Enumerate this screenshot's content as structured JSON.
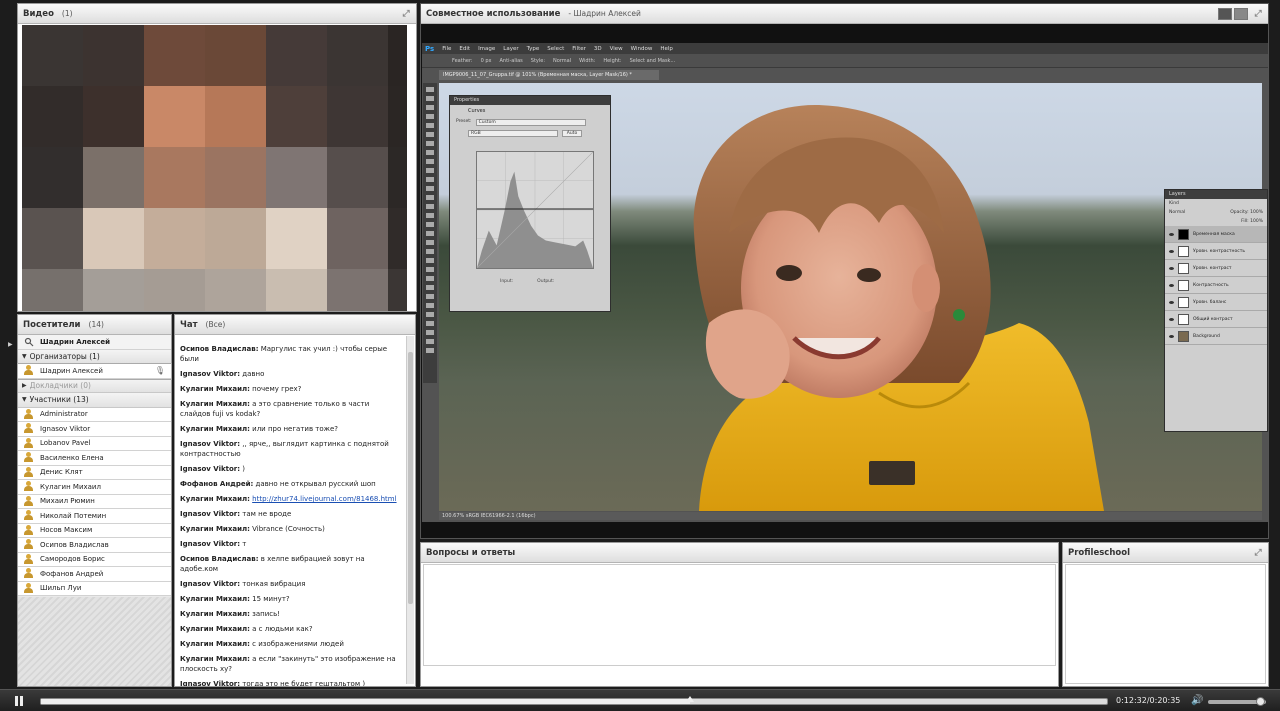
{
  "video_pod": {
    "title": "Видео",
    "count": "(1)"
  },
  "share_pod": {
    "title": "Совместное использование",
    "presenter": "- Шадрин Алексей"
  },
  "photoshop": {
    "logo": "Ps",
    "menu": [
      "File",
      "Edit",
      "Image",
      "Layer",
      "Type",
      "Select",
      "Filter",
      "3D",
      "View",
      "Window",
      "Help"
    ],
    "options": [
      "Feather:",
      "0 px",
      "Anti-alias",
      "Style:",
      "Normal",
      "Width:",
      "Height:",
      "Select and Mask..."
    ],
    "doc_tab": "IMGP9006_11_07_Gruppa.tif @ 101% (Временная маска, Layer Mask/16) *",
    "status": "100.67%    sRGB IEC61966-2.1 (16bpc)",
    "properties": {
      "title": "Properties",
      "adj": "Curves",
      "preset_label": "Preset:",
      "preset": "Custom",
      "channel": "RGB",
      "auto": "Auto",
      "input": "Input:",
      "output": "Output:"
    },
    "layers": {
      "title": "Layers",
      "kind": "Kind",
      "blend": "Normal",
      "opacity": "Opacity: 100%",
      "fill": "Fill: 100%",
      "items": [
        "Временная маска",
        "Уровн. контрастность",
        "Уровн. контраст",
        "Контрастность",
        "Уровн. баланс",
        "Общий контраст",
        "Background"
      ]
    }
  },
  "attendees_pod": {
    "title": "Посетители",
    "count": "(14)",
    "host": "Шадрин Алексей",
    "groups": [
      {
        "label": "Организаторы (1)"
      },
      {
        "label": "Докладчики (0)"
      },
      {
        "label": "Участники (13)"
      }
    ],
    "organizers": [
      "Шадрин Алексей"
    ],
    "participants": [
      "Administrator",
      "Ignasov Viktor",
      "Lobanov Pavel",
      "Василенко Елена",
      "Денис Клят",
      "Кулагин Михаил",
      "Михаил Рюмин",
      "Николай Потемин",
      "Носов Максим",
      "Осипов Владислав",
      "Самородов Борис",
      "Фофанов Андрей",
      "Шильп Луи"
    ]
  },
  "chat_pod": {
    "title": "Чат",
    "filter": "(Все)",
    "messages": [
      {
        "author": "Осипов Владислав:",
        "text": " Маргулис так учил :) чтобы серые были"
      },
      {
        "author": "Ignasov Viktor:",
        "text": " давно"
      },
      {
        "author": "Кулагин Михаил:",
        "text": " почему грех?"
      },
      {
        "author": "Кулагин Михаил:",
        "text": " а это сравнение только в части слайдов fuji vs kodak?"
      },
      {
        "author": "Кулагин Михаил:",
        "text": " или про негатив тоже?"
      },
      {
        "author": "Ignasov Viktor:",
        "text": " ,, ярче,, выглядит картинка с поднятой контрастностью"
      },
      {
        "author": "Ignasov Viktor:",
        "text": " )"
      },
      {
        "author": "Фофанов Андрей:",
        "text": " давно не открывал русский шоп"
      },
      {
        "author": "Кулагин Михаил:",
        "text": " ",
        "link": "http://zhur74.livejournal.com/81468.html"
      },
      {
        "author": "Ignasov Viktor:",
        "text": " там не вроде"
      },
      {
        "author": "Кулагин Михаил:",
        "text": "  Vibrance (Сочность)"
      },
      {
        "author": "Ignasov Viktor:",
        "text": " т"
      },
      {
        "author": "Осипов Владислав:",
        "text": " в хелпе вибрацией зовут на адобе.ком"
      },
      {
        "author": "Ignasov Viktor:",
        "text": " тонкая вибрация"
      },
      {
        "author": "Кулагин Михаил:",
        "text": " 15 минут?"
      },
      {
        "author": "Кулагин Михаил:",
        "text": " запись!"
      },
      {
        "author": "Кулагин Михаил:",
        "text": " а с людьми как?"
      },
      {
        "author": "Кулагин Михаил:",
        "text": " с изображениями людей"
      },
      {
        "author": "Кулагин Михаил:",
        "text": " а если \"закинуть\" это изображение на плоскость ху?"
      },
      {
        "author": "Ignasov Viktor:",
        "text": " тогда это не будет гештальтом )"
      }
    ]
  },
  "qa_pod": {
    "title": "Вопросы и ответы"
  },
  "profile_pod": {
    "title": "Profileschool"
  },
  "playback": {
    "time": "0:12:32/0:20:35",
    "progress": 0.609,
    "volume": 0.92
  },
  "colors": {
    "link": "#1a4fb3",
    "header_bg": "#e6e6e6",
    "stage_bg": "#111111"
  },
  "mosaic": [
    [
      "#3a3533",
      "#3c3330",
      "#6e4a3a",
      "#6a4837",
      "#453a38",
      "#3b3533",
      "#2a2523"
    ],
    [
      "#322c2a",
      "#3d302c",
      "#c98867",
      "#b67858",
      "#4e3f3a",
      "#3e3634",
      "#2b2624"
    ],
    [
      "#322e2d",
      "#7b7069",
      "#a9785f",
      "#9b7461",
      "#7f7573",
      "#564e4c",
      "#2c2826"
    ],
    [
      "#5a5350",
      "#d9c8b8",
      "#c4ad9a",
      "#bda997",
      "#e0d2c4",
      "#6e6360",
      "#302b29"
    ],
    [
      "#76706c",
      "#a49e98",
      "#a59c94",
      "#aea49b",
      "#c9bdb0",
      "#7c7370",
      "#3b3634"
    ],
    [
      "#6f6b69",
      "#8d8783",
      "#8d8681",
      "#948d88",
      "#9b948f",
      "#6a6462",
      "#3a3634"
    ]
  ]
}
